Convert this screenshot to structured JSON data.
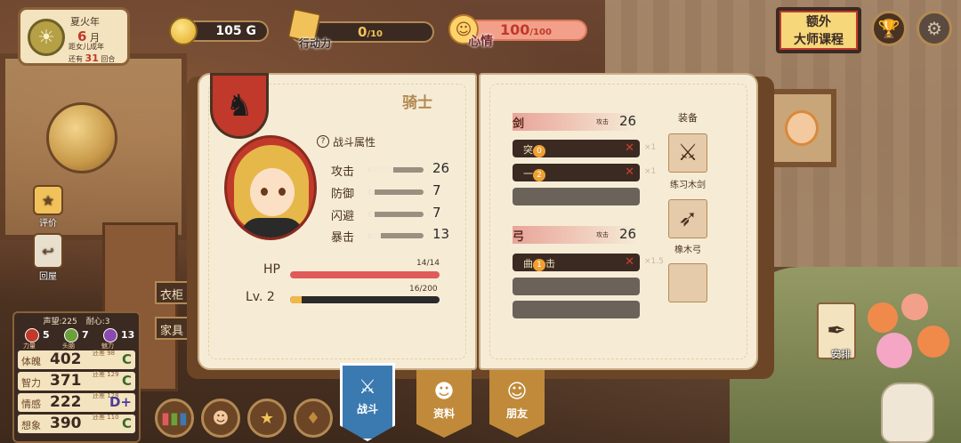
{
  "date": {
    "season": "夏火年",
    "month_num": "6",
    "month_unit": "月",
    "line1": "距女儿成年",
    "line2_prefix": "还有",
    "line2_num": "31",
    "line2_suffix": "回合"
  },
  "hud": {
    "gold": "105",
    "gold_unit": "G",
    "action_label": "行动力",
    "action_cur": "0",
    "action_max": "/10",
    "mood_label": "心情",
    "mood_cur": "100",
    "mood_max": "/100",
    "master_line1": "额外",
    "master_line2": "大师课程"
  },
  "side": {
    "eval_label": "评价",
    "home_label": "回屋",
    "tag1": "衣柜",
    "tag2": "家具"
  },
  "stats": {
    "reputation": "声望:225",
    "patience": "耐心:3",
    "attrs": [
      {
        "label": "力量",
        "value": "5",
        "color": "#c0392b"
      },
      {
        "label": "头脑",
        "value": "7",
        "color": "#6ca03a"
      },
      {
        "label": "魅力",
        "value": "13",
        "color": "#8a4ab0"
      }
    ],
    "rows": [
      {
        "label": "体魄",
        "value": "402",
        "sub": "还差 98",
        "grade": "C"
      },
      {
        "label": "智力",
        "value": "371",
        "sub": "还差 129",
        "grade": "C"
      },
      {
        "label": "情感",
        "value": "222",
        "sub": "还差 128",
        "grade": "D+"
      },
      {
        "label": "想象",
        "value": "390",
        "sub": "还差 110",
        "grade": "C"
      }
    ]
  },
  "book": {
    "class_title": "骑士",
    "battle_attr_label": "战斗属性",
    "attrs": [
      {
        "name": "攻击",
        "value": "26",
        "fill": 0.45
      },
      {
        "name": "防御",
        "value": "7",
        "fill": 0.12
      },
      {
        "name": "闪避",
        "value": "7",
        "fill": 0.12
      },
      {
        "name": "暴击",
        "value": "13",
        "fill": 0.22
      }
    ],
    "hp_label": "HP",
    "hp_text": "14/14",
    "hp_fill": 1.0,
    "lv_label": "Lv. 2",
    "lv_text": "16/200",
    "lv_fill": 0.08,
    "equip_title": "装备",
    "sword": {
      "name": "剑",
      "atk_label": "攻击",
      "atk_value": "26",
      "slots": [
        {
          "text": "突",
          "num": "0",
          "mult": "×1"
        },
        {
          "text": "一",
          "num": "2",
          "mult": "×1"
        }
      ],
      "equip_name": "练习木剑"
    },
    "bow": {
      "name": "弓",
      "atk_label": "攻击",
      "atk_value": "26",
      "slots": [
        {
          "text": "曲",
          "num": "1",
          "text2": "击",
          "mult": "×1.5"
        }
      ],
      "equip_name": "橡木弓"
    }
  },
  "tabs": {
    "battle": "战斗",
    "info": "资料",
    "friend": "朋友"
  },
  "arrange_label": "安排"
}
